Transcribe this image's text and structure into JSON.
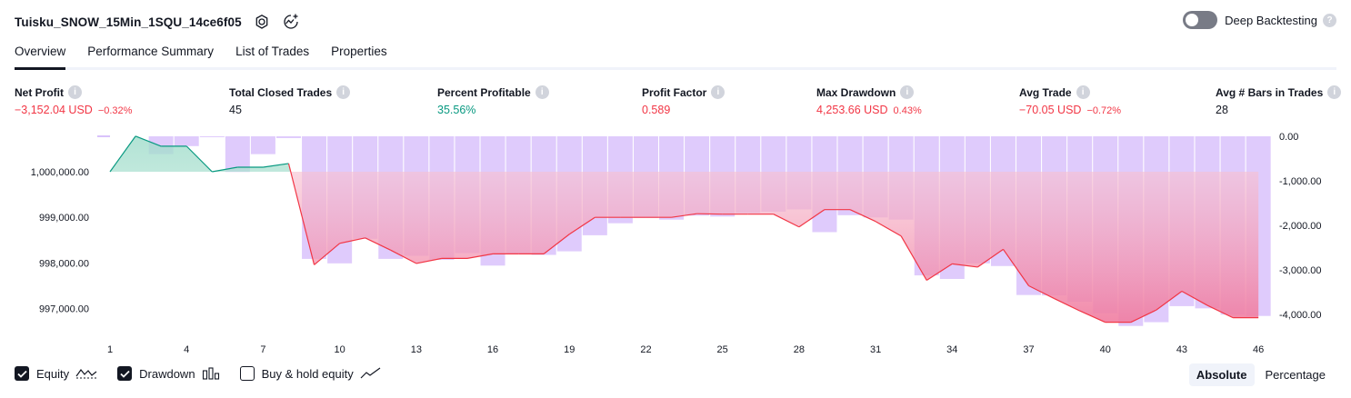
{
  "header": {
    "title": "Tuisku_SNOW_15Min_1SQU_14ce6f05",
    "deep_backtesting_label": "Deep Backtesting",
    "deep_backtesting_on": false
  },
  "tabs": [
    {
      "label": "Overview",
      "active": true
    },
    {
      "label": "Performance Summary",
      "active": false
    },
    {
      "label": "List of Trades",
      "active": false
    },
    {
      "label": "Properties",
      "active": false
    }
  ],
  "stats": {
    "net_profit": {
      "label": "Net Profit",
      "value": "−3,152.04 USD",
      "pct": "−0.32%"
    },
    "total_closed_trades": {
      "label": "Total Closed Trades",
      "value": "45"
    },
    "percent_profitable": {
      "label": "Percent Profitable",
      "value": "35.56%"
    },
    "profit_factor": {
      "label": "Profit Factor",
      "value": "0.589"
    },
    "max_drawdown": {
      "label": "Max Drawdown",
      "value": "4,253.66 USD",
      "pct": "0.43%"
    },
    "avg_trade": {
      "label": "Avg Trade",
      "value": "−70.05 USD",
      "pct": "−0.72%"
    },
    "avg_bars": {
      "label": "Avg # Bars in Trades",
      "value": "28"
    }
  },
  "legend": {
    "equity_label": "Equity",
    "equity_checked": true,
    "drawdown_label": "Drawdown",
    "drawdown_checked": true,
    "buyhold_label": "Buy & hold equity",
    "buyhold_checked": false
  },
  "mode": {
    "absolute_label": "Absolute",
    "percentage_label": "Percentage",
    "selected": "absolute"
  },
  "colors": {
    "profit_green": "#089981",
    "loss_red": "#f23645",
    "drawdown_purple": "#d9c2fb",
    "equity_fill_red": "#f28aa8",
    "equity_fill_green": "#c8ebe0",
    "text": "#131722"
  },
  "chart_data": {
    "type": "line",
    "baseline": 1000000,
    "x_ticks": [
      1,
      4,
      7,
      10,
      13,
      16,
      19,
      22,
      25,
      28,
      31,
      34,
      37,
      40,
      43,
      46
    ],
    "left_axis": {
      "ticks": [
        "1,000,000.00",
        "999,000.00",
        "998,000.00",
        "997,000.00"
      ],
      "range": [
        996600,
        1000800
      ]
    },
    "right_axis": {
      "ticks": [
        "0.00",
        "-1,000.00",
        "-2,000.00",
        "-3,000.00",
        "-4,000.00"
      ],
      "range": [
        -4200,
        0
      ]
    },
    "series": [
      {
        "name": "Equity",
        "x": [
          1,
          2,
          3,
          4,
          5,
          6,
          7,
          8,
          9,
          10,
          11,
          12,
          13,
          14,
          15,
          16,
          17,
          18,
          19,
          20,
          21,
          22,
          23,
          24,
          25,
          26,
          27,
          28,
          29,
          30,
          31,
          32,
          33,
          34,
          35,
          36,
          37,
          38,
          39,
          40,
          41,
          42,
          43,
          44,
          45,
          46
        ],
        "values": [
          1000000,
          1000780,
          1000560,
          1000560,
          1000000,
          1000100,
          1000100,
          1000180,
          997960,
          998430,
          998550,
          998280,
          997990,
          998100,
          998100,
          998200,
          998200,
          998200,
          998630,
          999000,
          999000,
          999000,
          999000,
          999080,
          999070,
          999070,
          999070,
          998790,
          999170,
          999170,
          998910,
          998590,
          997620,
          997980,
          997910,
          998300,
          997500,
          997220,
          996950,
          996700,
          996700,
          996970,
          997380,
          997070,
          996800,
          996800
        ]
      },
      {
        "name": "Drawdown",
        "x": [
          1,
          2,
          3,
          4,
          5,
          6,
          7,
          8,
          9,
          10,
          11,
          12,
          13,
          14,
          15,
          16,
          17,
          18,
          19,
          20,
          21,
          22,
          23,
          24,
          25,
          26,
          27,
          28,
          29,
          30,
          31,
          32,
          33,
          34,
          35,
          36,
          37,
          38,
          39,
          40,
          41,
          42,
          43,
          44,
          45,
          46
        ],
        "values": [
          0,
          0,
          -400,
          -220,
          -20,
          -800,
          -400,
          -40,
          -2750,
          -2850,
          -2300,
          -2750,
          -2680,
          -2770,
          -2620,
          -2900,
          -2640,
          -2660,
          -2580,
          -2220,
          -1950,
          -1830,
          -1870,
          -1780,
          -1800,
          -1720,
          -1690,
          -1640,
          -2150,
          -1770,
          -1820,
          -1870,
          -3120,
          -3200,
          -2850,
          -2910,
          -3560,
          -3570,
          -3710,
          -3970,
          -4254,
          -4170,
          -3810,
          -3860,
          -4000,
          -4030
        ]
      }
    ]
  }
}
